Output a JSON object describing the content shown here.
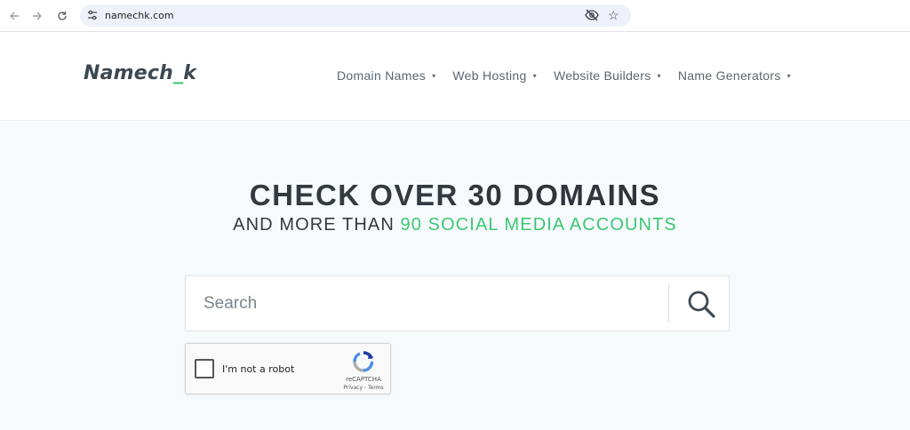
{
  "browser": {
    "url": "namechk.com",
    "icons": {
      "back": "arrow-left-icon",
      "forward": "arrow-right-icon",
      "reload": "reload-icon",
      "site_info": "tune-icon",
      "privacy": "eye-slash-icon",
      "bookmark": "star-icon"
    }
  },
  "header": {
    "logo": {
      "part1": "Namech",
      "part2": "_",
      "part3": "k"
    },
    "menu": [
      {
        "label": "Domain Names"
      },
      {
        "label": "Web Hosting"
      },
      {
        "label": "Website Builders"
      },
      {
        "label": "Name Generators"
      }
    ],
    "caret": "▾"
  },
  "hero": {
    "headline_prefix": "CHECK OVER ",
    "headline_strong": "30 DOMAINS",
    "subline_prefix": "AND MORE THAN ",
    "subline_highlight": "90 SOCIAL MEDIA ACCOUNTS"
  },
  "search": {
    "placeholder": "Search",
    "value": "",
    "button_icon": "search-icon"
  },
  "captcha": {
    "label": "I'm not a robot",
    "brand": "reCAPTCHA",
    "links": "Privacy - Terms",
    "checked": false
  },
  "colors": {
    "accent_green": "#3cc872",
    "logo_dark": "#3c4852",
    "hero_bg": "#f6fafd",
    "text_dark": "#333a40"
  }
}
